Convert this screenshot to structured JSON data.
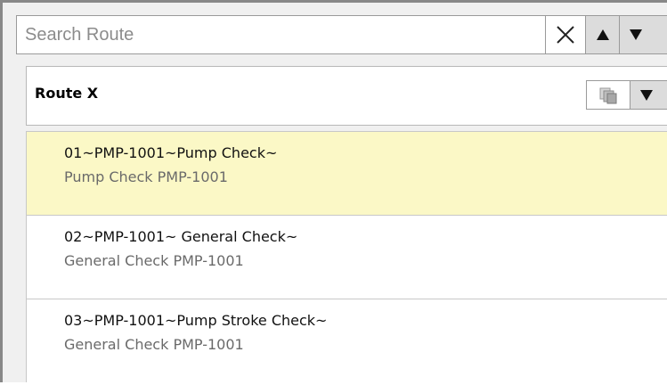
{
  "search": {
    "placeholder": "Search Route",
    "value": "",
    "clear_icon": "close-icon",
    "prev_icon": "triangle-up-icon",
    "next_icon": "triangle-down-icon"
  },
  "route": {
    "title": "Route X",
    "copy_icon": "copy-icon",
    "dropdown_icon": "triangle-down-icon"
  },
  "items": [
    {
      "title": "01~PMP-1001~Pump Check~",
      "subtitle": "Pump Check PMP-1001",
      "selected": true
    },
    {
      "title": "02~PMP-1001~ General Check~",
      "subtitle": "General Check PMP-1001",
      "selected": false
    },
    {
      "title": "03~PMP-1001~Pump Stroke Check~",
      "subtitle": "General Check PMP-1001",
      "selected": false
    }
  ],
  "colors": {
    "selected_background": "#fbf8c6",
    "button_background": "#dcdcdc",
    "border": "#9a9a9a"
  }
}
